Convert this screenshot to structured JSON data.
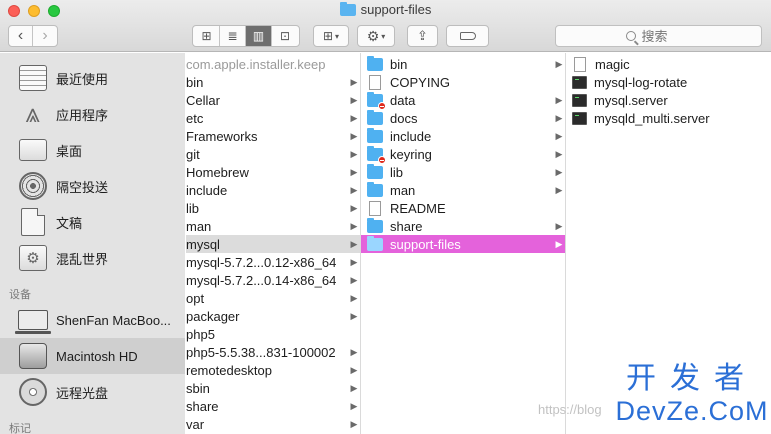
{
  "window": {
    "title": "support-files"
  },
  "toolbar": {
    "back_icon": "chevron-left",
    "forward_icon": "chevron-right",
    "view_modes": [
      "icon-view",
      "list-view",
      "column-view",
      "gallery-view"
    ],
    "active_view": "column-view",
    "search_placeholder": "搜索"
  },
  "sidebar": {
    "favorites": [
      {
        "label": "最近使用",
        "icon": "recents-icon"
      },
      {
        "label": "应用程序",
        "icon": "applications-icon"
      },
      {
        "label": "桌面",
        "icon": "desktop-icon"
      },
      {
        "label": "隔空投送",
        "icon": "airdrop-icon"
      },
      {
        "label": "文稿",
        "icon": "documents-icon"
      },
      {
        "label": "混乱世界",
        "icon": "folder-gear-icon"
      }
    ],
    "devices_header": "设备",
    "devices": [
      {
        "label": "ShenFan MacBoo...",
        "icon": "laptop-icon"
      },
      {
        "label": "Macintosh HD",
        "icon": "hard-drive-icon",
        "selected": true
      },
      {
        "label": "远程光盘",
        "icon": "disc-icon"
      }
    ],
    "tags_header": "标记"
  },
  "column1": [
    {
      "name": "com.apple.installer.keep",
      "dim": true,
      "arrow": false
    },
    {
      "name": "bin",
      "arrow": true
    },
    {
      "name": "Cellar",
      "arrow": true
    },
    {
      "name": "etc",
      "arrow": true
    },
    {
      "name": "Frameworks",
      "arrow": true
    },
    {
      "name": "git",
      "arrow": true
    },
    {
      "name": "Homebrew",
      "arrow": true
    },
    {
      "name": "include",
      "arrow": true
    },
    {
      "name": "lib",
      "arrow": true
    },
    {
      "name": "man",
      "arrow": true
    },
    {
      "name": "mysql",
      "arrow": true,
      "selected": true
    },
    {
      "name": "mysql-5.7.2...0.12-x86_64",
      "arrow": true
    },
    {
      "name": "mysql-5.7.2...0.14-x86_64",
      "arrow": true
    },
    {
      "name": "opt",
      "arrow": true
    },
    {
      "name": "packager",
      "arrow": true
    },
    {
      "name": "php5",
      "arrow": false
    },
    {
      "name": "php5-5.5.38...831-100002",
      "arrow": true
    },
    {
      "name": "remotedesktop",
      "arrow": true
    },
    {
      "name": "sbin",
      "arrow": true
    },
    {
      "name": "share",
      "arrow": true
    },
    {
      "name": "var",
      "arrow": true
    }
  ],
  "column2": [
    {
      "name": "bin",
      "type": "folder",
      "arrow": true
    },
    {
      "name": "COPYING",
      "type": "doc",
      "arrow": false
    },
    {
      "name": "data",
      "type": "folder",
      "badge": true,
      "arrow": true
    },
    {
      "name": "docs",
      "type": "folder",
      "arrow": true
    },
    {
      "name": "include",
      "type": "folder",
      "arrow": true
    },
    {
      "name": "keyring",
      "type": "folder",
      "badge": true,
      "arrow": true
    },
    {
      "name": "lib",
      "type": "folder",
      "arrow": true
    },
    {
      "name": "man",
      "type": "folder",
      "arrow": true
    },
    {
      "name": "README",
      "type": "doc",
      "arrow": false
    },
    {
      "name": "share",
      "type": "folder",
      "arrow": true
    },
    {
      "name": "support-files",
      "type": "folder",
      "arrow": true,
      "selected": true
    }
  ],
  "column3": [
    {
      "name": "magic",
      "type": "doc"
    },
    {
      "name": "mysql-log-rotate",
      "type": "term"
    },
    {
      "name": "mysql.server",
      "type": "term"
    },
    {
      "name": "mysqld_multi.server",
      "type": "term"
    }
  ],
  "watermark": {
    "text": "https://blog",
    "logo_line1": "开发者",
    "logo_line2": "DevZe.CoM"
  }
}
